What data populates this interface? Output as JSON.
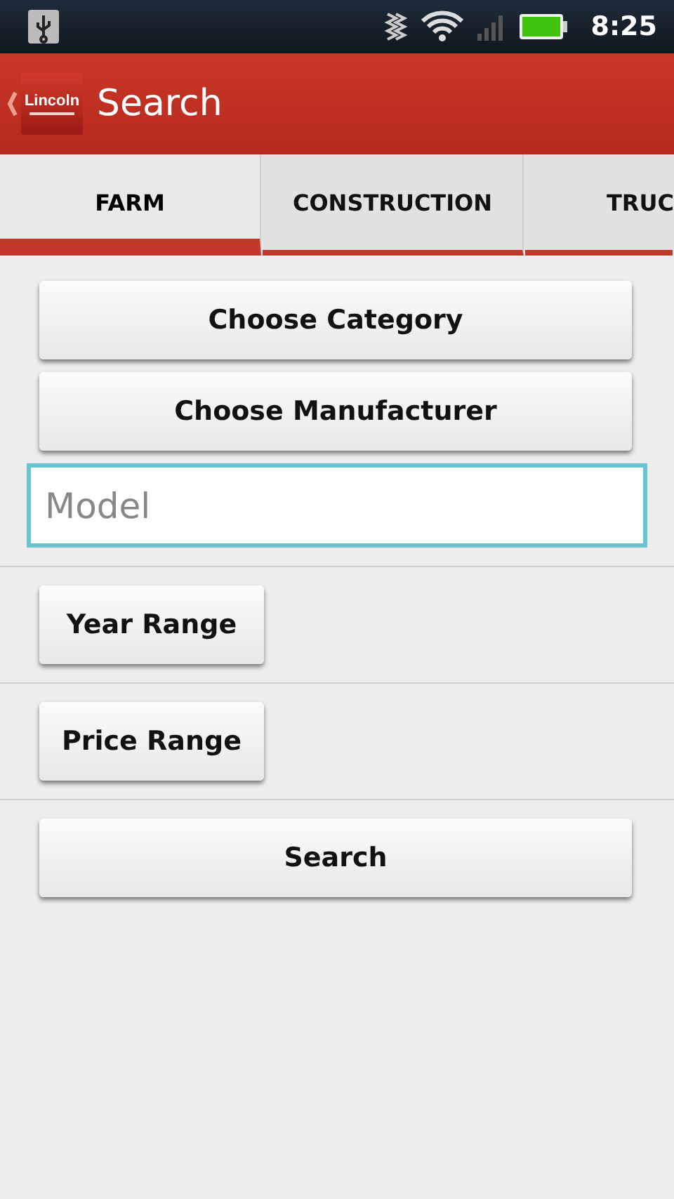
{
  "status_bar": {
    "time": "8:25"
  },
  "action_bar": {
    "logo": {
      "name": "Lincoln"
    },
    "title": "Search"
  },
  "tabs": [
    {
      "label": "FARM",
      "selected": true
    },
    {
      "label": "CONSTRUCTION",
      "selected": false
    },
    {
      "label": "TRUC",
      "selected": false
    }
  ],
  "form": {
    "category_button": "Choose Category",
    "manufacturer_button": "Choose Manufacturer",
    "model_field": {
      "placeholder": "Model"
    },
    "year_button": "Year Range",
    "price_button": "Price Range",
    "search_button": "Search"
  }
}
